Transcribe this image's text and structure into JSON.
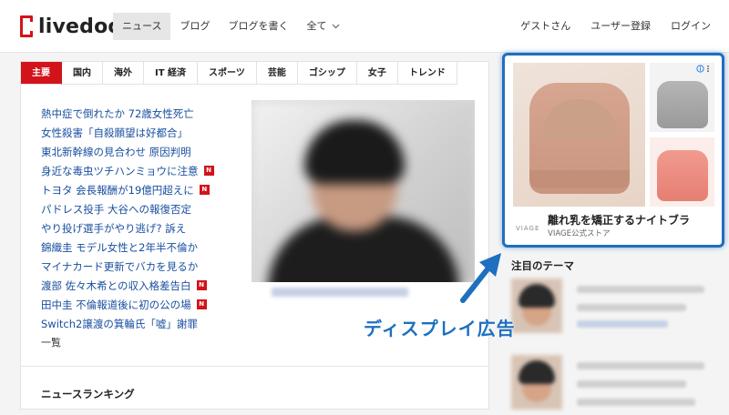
{
  "header": {
    "logo_text": "livedoor",
    "nav": [
      {
        "label": "ニュース"
      },
      {
        "label": "ブログ"
      },
      {
        "label": "ブログを書く"
      },
      {
        "label": "全て"
      }
    ],
    "user_nav": [
      {
        "label": "ゲストさん"
      },
      {
        "label": "ユーザー登録"
      },
      {
        "label": "ログイン"
      }
    ]
  },
  "news": {
    "tabs": [
      {
        "label": "主要"
      },
      {
        "label": "国内"
      },
      {
        "label": "海外"
      },
      {
        "label": "IT 経済"
      },
      {
        "label": "スポーツ"
      },
      {
        "label": "芸能"
      },
      {
        "label": "ゴシップ"
      },
      {
        "label": "女子"
      },
      {
        "label": "トレンド"
      }
    ],
    "items": [
      {
        "text": "熱中症で倒れたか 72歳女性死亡",
        "new": false
      },
      {
        "text": "女性殺害「自殺願望は好都合」",
        "new": false
      },
      {
        "text": "東北新幹線の見合わせ 原因判明",
        "new": false
      },
      {
        "text": "身近な毒虫ツチハンミョウに注意",
        "new": true
      },
      {
        "text": "トヨタ 会長報酬が19億円超えに",
        "new": true
      },
      {
        "text": "パドレス投手 大谷への報復否定",
        "new": false
      },
      {
        "text": "やり投げ選手がやり逃げ? 訴え",
        "new": false
      },
      {
        "text": "錦織圭 モデル女性と2年半不倫か",
        "new": false
      },
      {
        "text": "マイナカード更新でバカを見るか",
        "new": false
      },
      {
        "text": "渡部 佐々木希との収入格差告白",
        "new": true
      },
      {
        "text": "田中圭 不倫報道後に初の公の場",
        "new": true
      },
      {
        "text": "Switch2譲渡の箕輪氏「嘘」謝罪",
        "new": false
      }
    ],
    "new_badge": "N",
    "more_label": "一覧",
    "ranking_title": "ニュースランキング"
  },
  "ad": {
    "choice_icon": "info-icon",
    "brand_mark": "VIAGE",
    "headline": "離れ乳を矯正するナイトブラ",
    "sponsor": "VIAGE公式ストア"
  },
  "sidebar": {
    "theme_title": "注目のテーマ"
  },
  "annotation": {
    "label": "ディスプレイ広告",
    "color": "#1e6fbf"
  },
  "colors": {
    "brand_red": "#d3131a",
    "link_blue": "#1a4fa0"
  }
}
